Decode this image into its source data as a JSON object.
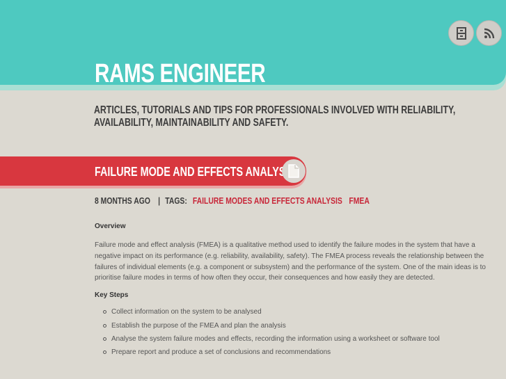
{
  "site": {
    "title": "RAMS ENGINEER",
    "tagline": "ARTICLES, TUTORIALS AND TIPS FOR PROFESSIONALS INVOLVED WITH RELIABILITY, AVAILABILITY, MAINTAINABILITY AND SAFETY."
  },
  "header_icons": {
    "archive": "archive-icon",
    "rss": "rss-icon"
  },
  "post": {
    "title": "FAILURE MODE AND EFFECTS ANALYSIS",
    "type_icon": "document-icon",
    "meta": {
      "time": "8 MONTHS AGO",
      "separator": "|",
      "tags_label": "TAGS:",
      "tags": [
        "FAILURE MODES AND EFFECTS ANALYSIS",
        "FMEA"
      ]
    },
    "body": {
      "overview_heading": "Overview",
      "overview_text": "Failure mode and effect analysis (FMEA) is a qualitative method used to identify the failure modes in the system that have a negative impact on its performance (e.g. reliability, availability, safety). The FMEA process reveals the relationship between the failures of individual elements (e.g. a component or subsystem) and the performance of the system. One of the main ideas is to prioritise failure modes in terms of how often they occur, their consequences and how easily they are detected.",
      "steps_heading": "Key Steps",
      "steps": [
        "Collect information on the system to be analysed",
        "Establish the purpose of the FMEA and plan the analysis",
        "Analyse the system failure modes and effects, recording the information using a worksheet or software tool",
        "Prepare report and produce a set of conclusions and recommendations"
      ]
    }
  },
  "colors": {
    "header": "#4ec9c0",
    "banner": "#d8373f",
    "tag": "#c8283a",
    "background": "#dcd9d1"
  }
}
